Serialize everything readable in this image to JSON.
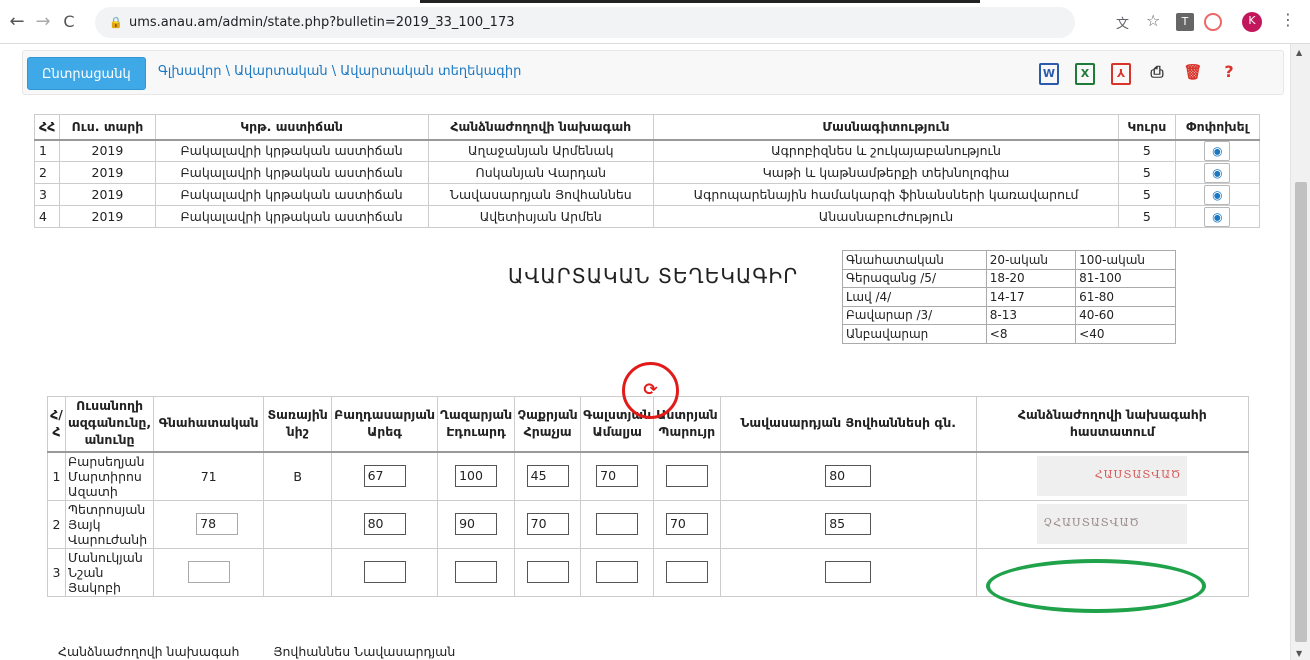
{
  "browser": {
    "url": "ums.anau.am/admin/state.php?bulletin=2019_33_100_173",
    "profile_initial": "K"
  },
  "toolbar": {
    "home_button": "Ընտրացանկ",
    "breadcrumb": "Գլխավոր \\ Ավարտական \\ Ավարտական տեղեկագիր",
    "icons": [
      "word-icon",
      "excel-icon",
      "pdf-icon",
      "print-icon",
      "delete-icon",
      "help-icon"
    ],
    "help_label": "?"
  },
  "info_table": {
    "headers": [
      "ՀՀ",
      "Ուս. տարի",
      "Կրթ. աստիճան",
      "Հանձնաժողովի նախագահ",
      "Մասնագիտություն",
      "Կուրս",
      "Փոփոխել"
    ],
    "rows": [
      [
        "1",
        "2019",
        "Բակալավրի կրթական աստիճան",
        "Աղաջանյան Արմենակ",
        "Ագրոբիզնես և շուկայաբանություն",
        "5"
      ],
      [
        "2",
        "2019",
        "Բակալավրի կրթական աստիճան",
        "Ոսկանյան Վարդան",
        "Կաթի և կաթնամթերքի տեխնոլոգիա",
        "5"
      ],
      [
        "3",
        "2019",
        "Բակալավրի կրթական աստիճան",
        "Նավասարդյան Յովհաննես",
        "Ագրոպարենային համակարգի ֆինանսների կառավարում",
        "5"
      ],
      [
        "4",
        "2019",
        "Բակալավրի կրթական աստիճան",
        "Ավետիսյան Արմեն",
        "Անասնաբուժություն",
        "5"
      ]
    ]
  },
  "page_title": "ԱՎԱՐՏԱԿԱՆ ՏԵՂԵԿԱԳԻՐ",
  "scale_table": {
    "rows": [
      [
        "Գնահատական",
        "20-ական",
        "100-ական"
      ],
      [
        "Գերազանց /5/",
        "18-20",
        "81-100"
      ],
      [
        "Լավ /4/",
        "14-17",
        "61-80"
      ],
      [
        "Բավարար /3/",
        "8-13",
        "40-60"
      ],
      [
        "Անբավարար",
        "<8",
        "<40"
      ]
    ]
  },
  "grade_table": {
    "headers": [
      "Հ/Հ",
      "Ուսանողի ազգանունը, անունը",
      "Գնահատական",
      "Տառային նիշ",
      "Բաղդասարյան Արեգ",
      "Ղազարյան Էդուարդ",
      "Չաքրյան Հրաչյա",
      "Գալստյան Ամալյա",
      "Աստրյան Պարույր",
      "Նավասարդյան Յովհաննեսի գն.",
      "Հանձնաժողովի նախագահի հաստատում"
    ],
    "rows": [
      {
        "num": "1",
        "name": "Բարսեղյան Մարտիրոս Ազատի",
        "grade": "71",
        "letter": "B",
        "scores": [
          "67",
          "100",
          "45",
          "70",
          ""
        ],
        "chair": "80",
        "stamp": "ՀԱՍՏԱՏՎԱԾ"
      },
      {
        "num": "2",
        "name": "Պետրոսյան Յայկ Վարուժանի",
        "grade": "78",
        "letter": "",
        "scores": [
          "80",
          "90",
          "70",
          "",
          "70"
        ],
        "chair": "85",
        "stamp": "ՉՀԱՍՏԱՏՎԱԾ"
      },
      {
        "num": "3",
        "name": "Մանուկյան Նշան Յակոբի",
        "grade": "",
        "letter": "",
        "scores": [
          "",
          "",
          "",
          "",
          ""
        ],
        "chair": "",
        "stamp": ""
      }
    ]
  },
  "footer": {
    "left": "Հանձնաժողովի նախագահ",
    "right": "Յովհաննես Նավասարդյան"
  },
  "colors": {
    "accent": "#3fa9e8",
    "link": "#1a78c2",
    "annotation_red": "#e21a1a",
    "annotation_green": "#1fa24a"
  }
}
